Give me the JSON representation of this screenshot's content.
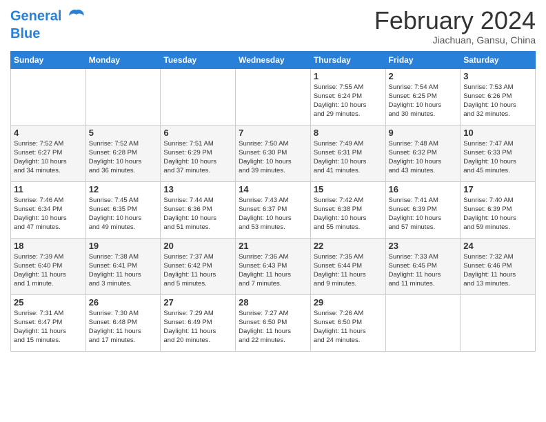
{
  "logo": {
    "line1": "General",
    "line2": "Blue"
  },
  "title": "February 2024",
  "location": "Jiachuan, Gansu, China",
  "days_of_week": [
    "Sunday",
    "Monday",
    "Tuesday",
    "Wednesday",
    "Thursday",
    "Friday",
    "Saturday"
  ],
  "weeks": [
    [
      {
        "day": "",
        "info": ""
      },
      {
        "day": "",
        "info": ""
      },
      {
        "day": "",
        "info": ""
      },
      {
        "day": "",
        "info": ""
      },
      {
        "day": "1",
        "info": "Sunrise: 7:55 AM\nSunset: 6:24 PM\nDaylight: 10 hours\nand 29 minutes."
      },
      {
        "day": "2",
        "info": "Sunrise: 7:54 AM\nSunset: 6:25 PM\nDaylight: 10 hours\nand 30 minutes."
      },
      {
        "day": "3",
        "info": "Sunrise: 7:53 AM\nSunset: 6:26 PM\nDaylight: 10 hours\nand 32 minutes."
      }
    ],
    [
      {
        "day": "4",
        "info": "Sunrise: 7:52 AM\nSunset: 6:27 PM\nDaylight: 10 hours\nand 34 minutes."
      },
      {
        "day": "5",
        "info": "Sunrise: 7:52 AM\nSunset: 6:28 PM\nDaylight: 10 hours\nand 36 minutes."
      },
      {
        "day": "6",
        "info": "Sunrise: 7:51 AM\nSunset: 6:29 PM\nDaylight: 10 hours\nand 37 minutes."
      },
      {
        "day": "7",
        "info": "Sunrise: 7:50 AM\nSunset: 6:30 PM\nDaylight: 10 hours\nand 39 minutes."
      },
      {
        "day": "8",
        "info": "Sunrise: 7:49 AM\nSunset: 6:31 PM\nDaylight: 10 hours\nand 41 minutes."
      },
      {
        "day": "9",
        "info": "Sunrise: 7:48 AM\nSunset: 6:32 PM\nDaylight: 10 hours\nand 43 minutes."
      },
      {
        "day": "10",
        "info": "Sunrise: 7:47 AM\nSunset: 6:33 PM\nDaylight: 10 hours\nand 45 minutes."
      }
    ],
    [
      {
        "day": "11",
        "info": "Sunrise: 7:46 AM\nSunset: 6:34 PM\nDaylight: 10 hours\nand 47 minutes."
      },
      {
        "day": "12",
        "info": "Sunrise: 7:45 AM\nSunset: 6:35 PM\nDaylight: 10 hours\nand 49 minutes."
      },
      {
        "day": "13",
        "info": "Sunrise: 7:44 AM\nSunset: 6:36 PM\nDaylight: 10 hours\nand 51 minutes."
      },
      {
        "day": "14",
        "info": "Sunrise: 7:43 AM\nSunset: 6:37 PM\nDaylight: 10 hours\nand 53 minutes."
      },
      {
        "day": "15",
        "info": "Sunrise: 7:42 AM\nSunset: 6:38 PM\nDaylight: 10 hours\nand 55 minutes."
      },
      {
        "day": "16",
        "info": "Sunrise: 7:41 AM\nSunset: 6:39 PM\nDaylight: 10 hours\nand 57 minutes."
      },
      {
        "day": "17",
        "info": "Sunrise: 7:40 AM\nSunset: 6:39 PM\nDaylight: 10 hours\nand 59 minutes."
      }
    ],
    [
      {
        "day": "18",
        "info": "Sunrise: 7:39 AM\nSunset: 6:40 PM\nDaylight: 11 hours\nand 1 minute."
      },
      {
        "day": "19",
        "info": "Sunrise: 7:38 AM\nSunset: 6:41 PM\nDaylight: 11 hours\nand 3 minutes."
      },
      {
        "day": "20",
        "info": "Sunrise: 7:37 AM\nSunset: 6:42 PM\nDaylight: 11 hours\nand 5 minutes."
      },
      {
        "day": "21",
        "info": "Sunrise: 7:36 AM\nSunset: 6:43 PM\nDaylight: 11 hours\nand 7 minutes."
      },
      {
        "day": "22",
        "info": "Sunrise: 7:35 AM\nSunset: 6:44 PM\nDaylight: 11 hours\nand 9 minutes."
      },
      {
        "day": "23",
        "info": "Sunrise: 7:33 AM\nSunset: 6:45 PM\nDaylight: 11 hours\nand 11 minutes."
      },
      {
        "day": "24",
        "info": "Sunrise: 7:32 AM\nSunset: 6:46 PM\nDaylight: 11 hours\nand 13 minutes."
      }
    ],
    [
      {
        "day": "25",
        "info": "Sunrise: 7:31 AM\nSunset: 6:47 PM\nDaylight: 11 hours\nand 15 minutes."
      },
      {
        "day": "26",
        "info": "Sunrise: 7:30 AM\nSunset: 6:48 PM\nDaylight: 11 hours\nand 17 minutes."
      },
      {
        "day": "27",
        "info": "Sunrise: 7:29 AM\nSunset: 6:49 PM\nDaylight: 11 hours\nand 20 minutes."
      },
      {
        "day": "28",
        "info": "Sunrise: 7:27 AM\nSunset: 6:50 PM\nDaylight: 11 hours\nand 22 minutes."
      },
      {
        "day": "29",
        "info": "Sunrise: 7:26 AM\nSunset: 6:50 PM\nDaylight: 11 hours\nand 24 minutes."
      },
      {
        "day": "",
        "info": ""
      },
      {
        "day": "",
        "info": ""
      }
    ]
  ]
}
